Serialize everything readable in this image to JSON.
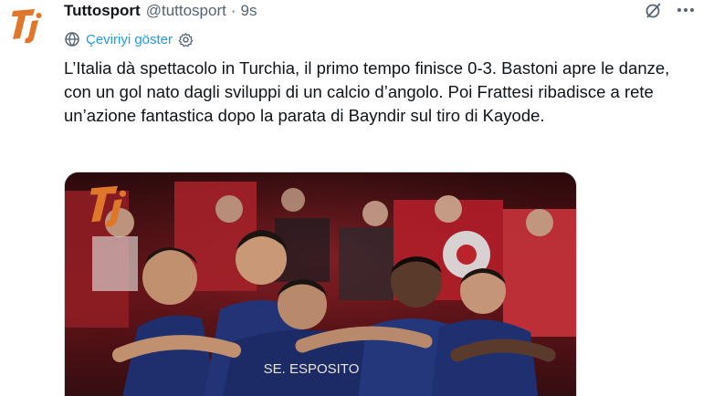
{
  "tweet": {
    "display_name": "Tuttosport",
    "handle": "@tuttosport",
    "separator": "·",
    "time": "9s",
    "translate_label": "Çeviriyi göster",
    "text": "L’Italia dà spettacolo in Turchia, il primo tempo finisce 0-3. Bastoni apre le danze, con un gol nato dagli sviluppi di un calcio d’angolo. Poi Frattesi ribadisce a rete un’azione fantastica dopo la parata di Bayndir sul tiro di Kayode.",
    "avatar_logo": "Tj"
  },
  "media": {
    "watermark_logo": "Tj",
    "jersey_name": "SE. ESPOSITO",
    "description_icon": "photo-icon"
  },
  "icons": {
    "grok": "grok-icon",
    "more": "more-icon",
    "translate": "globe-icon",
    "settings": "settings-icon"
  },
  "colors": {
    "link": "#1d9bf0",
    "secondary_text": "#536471",
    "brand_orange": "#e0762a",
    "jersey_blue": "#1f2f6e",
    "crowd_red": "#b21f2a"
  }
}
